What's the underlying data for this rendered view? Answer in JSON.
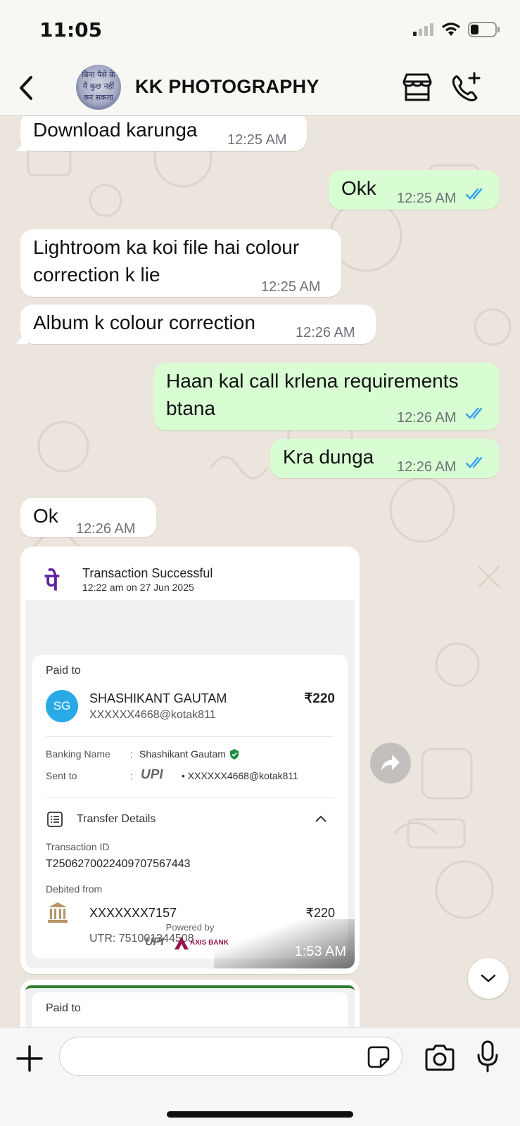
{
  "status_bar": {
    "time": "11:05"
  },
  "header": {
    "title": "KK PHOTOGRAPHY",
    "avatar_text": [
      "बिना पैसे के",
      "मैं कुछ नहीं",
      "कर सकता"
    ]
  },
  "messages": [
    {
      "dir": "in",
      "text": "Download karunga",
      "time": "12:25 AM"
    },
    {
      "dir": "out",
      "text": "Okk",
      "time": "12:25 AM",
      "status": "read"
    },
    {
      "dir": "in",
      "lines": [
        "Lightroom ka koi file hai colour",
        "correction k lie"
      ],
      "time": "12:25 AM"
    },
    {
      "dir": "in",
      "text": "Album k colour correction",
      "time": "12:26 AM"
    },
    {
      "dir": "out",
      "lines": [
        "Haan kal call krlena requirements",
        "btana"
      ],
      "time": "12:26 AM",
      "status": "read"
    },
    {
      "dir": "out",
      "text": "Kra dunga",
      "time": "12:26 AM",
      "status": "read"
    },
    {
      "dir": "in",
      "text": "Ok",
      "time": "12:26 AM"
    }
  ],
  "payment_card": {
    "logo": "पे",
    "title": "Transaction Successful",
    "subtitle": "12:22 am on 27 Jun 2025",
    "paid_to_label": "Paid to",
    "payee_initials": "SG",
    "payee_name": "SHASHIKANT GAUTAM",
    "payee_upi": "XXXXXX4668@kotak811",
    "amount": "₹220",
    "banking_name_label": "Banking Name",
    "banking_name": "Shashikant Gautam",
    "sent_to_label": "Sent to",
    "sent_to": "• XXXXXX4668@kotak811",
    "transfer_details_label": "Transfer Details",
    "transaction_id_label": "Transaction ID",
    "transaction_id": "T2506270022409707567443",
    "debited_from_label": "Debited from",
    "account": "XXXXXXX7157",
    "debited_amount": "₹220",
    "utr": "UTR: 751001344508",
    "powered_by": "Powered by",
    "upi_logo": "UPI",
    "bank_logo": "AXIS BANK",
    "time": "1:53 AM"
  },
  "payment_card_2": {
    "paid_to_label": "Paid to"
  },
  "colors": {
    "outgoing_bubble": "#d9fdd3",
    "incoming_bubble": "#ffffff",
    "read_tick": "#34a3f0",
    "chat_bg": "#ece5dd",
    "phonepe": "#5f259f"
  }
}
